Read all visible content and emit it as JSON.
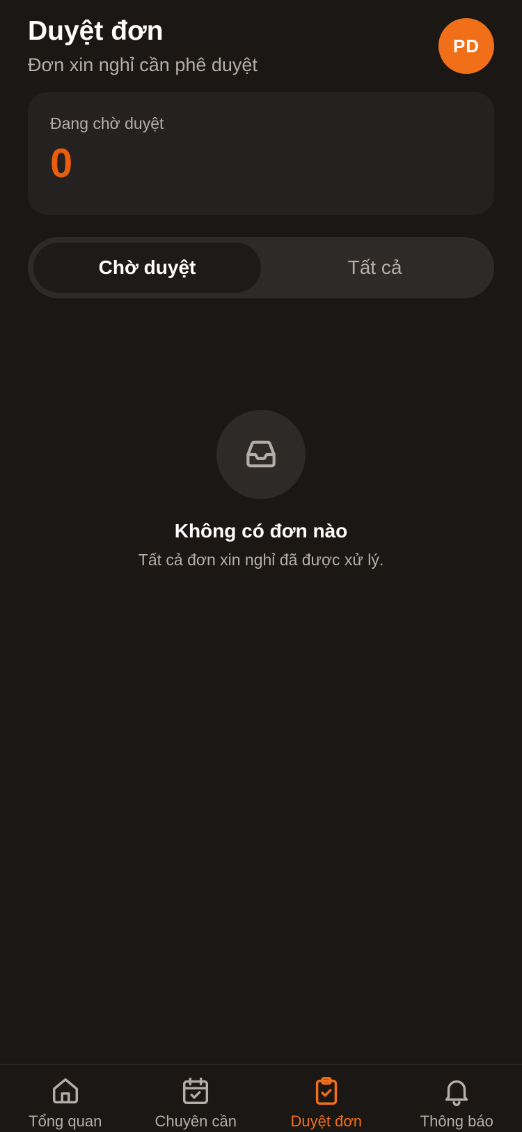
{
  "header": {
    "title": "Duyệt đơn",
    "subtitle": "Đơn xin nghỉ cần phê duyệt",
    "avatar_initials": "PD"
  },
  "stat_card": {
    "label": "Đang chờ duyệt",
    "value": "0"
  },
  "tabs": [
    {
      "label": "Chờ duyệt",
      "active": true
    },
    {
      "label": "Tất cả",
      "active": false
    }
  ],
  "empty_state": {
    "icon": "inbox-icon",
    "title": "Không có đơn nào",
    "description": "Tất cả đơn xin nghỉ đã được xử lý."
  },
  "bottom_nav": [
    {
      "label": "Tổng quan",
      "icon": "home-icon",
      "active": false
    },
    {
      "label": "Chuyên cần",
      "icon": "calendar-check-icon",
      "active": false
    },
    {
      "label": "Duyệt đơn",
      "icon": "clipboard-check-icon",
      "active": true
    },
    {
      "label": "Thông báo",
      "icon": "bell-icon",
      "active": false
    }
  ],
  "colors": {
    "background": "#1b1714",
    "card": "#252120",
    "accent": "#f26f1a",
    "stat_value": "#ea5d0c",
    "muted_text": "#b5aea8"
  }
}
